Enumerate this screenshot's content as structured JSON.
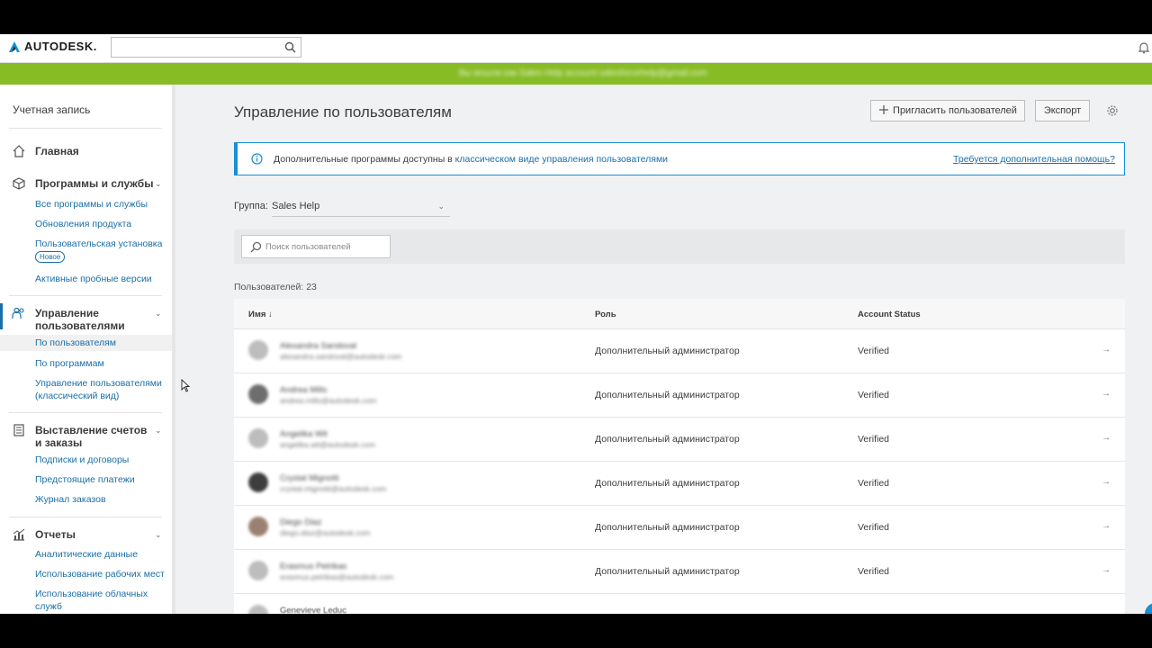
{
  "app": {
    "brand": "AUTODESK.",
    "search_value": "",
    "banner_text": "Вы вошли как Sales Help account salesforcehelp@gmail.com"
  },
  "sidebar": {
    "account_title": "Учетная запись",
    "sections": [
      {
        "label": "Главная",
        "icon": "home-icon"
      },
      {
        "label": "Программы и службы",
        "icon": "box-icon",
        "items": [
          "Все программы и службы",
          "Обновления продукта",
          "Пользовательская установка",
          "Активные пробные версии"
        ],
        "badge": "Новое"
      },
      {
        "label": "Управление пользователями",
        "icon": "users-icon",
        "items": [
          "По пользователям",
          "По программам",
          "Управление пользователями (классический вид)"
        ]
      },
      {
        "label": "Выставление счетов и заказы",
        "icon": "billing-icon",
        "items": [
          "Подписки и договоры",
          "Предстоящие платежи",
          "Журнал заказов"
        ]
      },
      {
        "label": "Отчеты",
        "icon": "reports-icon",
        "items": [
          "Аналитические данные",
          "Использование рабочих мест",
          "Использование облачных служб"
        ]
      }
    ]
  },
  "main": {
    "title": "Управление по пользователям",
    "invite_label": "Пригласить пользователей",
    "export_label": "Экспорт",
    "info": {
      "prefix": "Дополнительные программы доступны в ",
      "link": "классическом виде управления пользователями",
      "help": "Требуется дополнительная помощь?"
    },
    "group_label": "Группа:",
    "group_value": "Sales Help",
    "search_placeholder": "Поиск пользователей",
    "users_count": "Пользователей: 23",
    "columns": {
      "name": "Имя ↓",
      "role": "Роль",
      "status": "Account Status"
    },
    "rows": [
      {
        "name": "Alexandra Sandoval",
        "email": "alexandra.sandoval@autodesk.com",
        "role": "Дополнительный администратор",
        "status": "Verified",
        "arrow": "→"
      },
      {
        "name": "Andrea Mills",
        "email": "andrea.mills@autodesk.com",
        "role": "Дополнительный администратор",
        "status": "Verified",
        "arrow": "→"
      },
      {
        "name": "Angelika Wit",
        "email": "angelika.wit@autodesk.com",
        "role": "Дополнительный администратор",
        "status": "Verified",
        "arrow": "→"
      },
      {
        "name": "Crystal Mignotti",
        "email": "crystal.mignotti@autodesk.com",
        "role": "Дополнительный администратор",
        "status": "Verified",
        "arrow": "→"
      },
      {
        "name": "Diego Diaz",
        "email": "diego.diaz@autodesk.com",
        "role": "Дополнительный администратор",
        "status": "Verified",
        "arrow": "→"
      },
      {
        "name": "Erasmus Petrikas",
        "email": "erasmus.petrikas@autodesk.com",
        "role": "Дополнительный администратор",
        "status": "Verified",
        "arrow": "→"
      },
      {
        "name": "Genevieve Leduc",
        "email": "",
        "role": "",
        "status": "",
        "arrow": ""
      }
    ]
  }
}
